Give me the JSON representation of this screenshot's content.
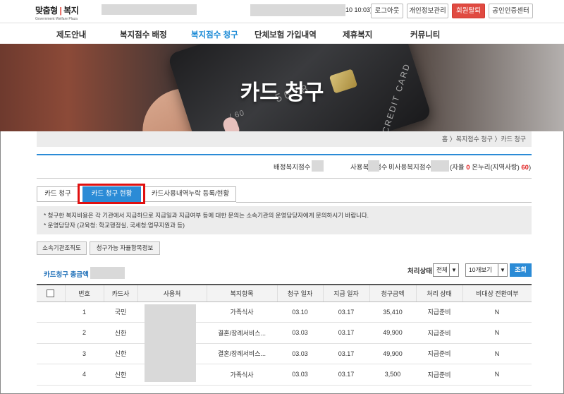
{
  "header": {
    "logo_main": "맞춤형",
    "logo_sub": "복지",
    "logo_tagline": "Government Welfare Plaza",
    "time": "10 10:03)",
    "buttons": [
      "로그아웃",
      "개인정보관리",
      "회원탈퇴",
      "공인인증센터"
    ]
  },
  "nav": [
    "제도안내",
    "복지점수 배정",
    "복지점수 청구",
    "단체보험 가입내역",
    "제휴복지",
    "커뮤니티"
  ],
  "hero": {
    "title": "카드 청구",
    "card_text": "CREDIT CARD",
    "card_number": "5678",
    "card_expiry": "/ 60"
  },
  "breadcrumb": "홈 〉복지점수 청구 〉카드 청구",
  "points": {
    "assigned_label": "배정복지점수 :",
    "used_label": "사용복지점수 :",
    "unused_label": "미사용복지점수 :",
    "detail_prefix": "(자율",
    "self_value": "0",
    "onnuri_label": "온누리(지역사랑)",
    "onnuri_value": "60",
    "detail_suffix": ")"
  },
  "tabs": [
    "카드 청구",
    "카드 청구 현황",
    "카드사용내역누락 등록/현황"
  ],
  "notice": [
    "* 청구한 복지비용은 각 기관에서 지급하므로 지급일과 지급여부 등에 대한 문의는 소속기관의 운영담당자에게 문의하시기 바랍니다.",
    "* 운영담당자 (교육청: 학교행정실, 국세청:업무지원과 등)"
  ],
  "action_buttons": [
    "소속기관조직도",
    "청구가능 자율항목정보"
  ],
  "total_label": "카드청구 총금액 :",
  "filter": {
    "status_label": "처리상태",
    "status_value": "전체",
    "page_size": "10개보기",
    "search_label": "조회"
  },
  "table": {
    "headers": [
      "",
      "번호",
      "카드사",
      "사용처",
      "복지항목",
      "청구 일자",
      "지급 일자",
      "청구금액",
      "처리 상태",
      "비대상 전환여부"
    ],
    "rows": [
      {
        "no": "1",
        "card": "국민",
        "item": "가족식사",
        "claim_date": "03.10",
        "pay_date": "03.17",
        "amount": "35,410",
        "status": "지급준비",
        "convert": "N"
      },
      {
        "no": "2",
        "card": "신한",
        "item": "결혼/장례서비스...",
        "claim_date": "03.03",
        "pay_date": "03.17",
        "amount": "49,900",
        "status": "지급준비",
        "convert": "N"
      },
      {
        "no": "3",
        "card": "신한",
        "item": "결혼/장례서비스...",
        "claim_date": "03.03",
        "pay_date": "03.17",
        "amount": "49,900",
        "status": "지급준비",
        "convert": "N"
      },
      {
        "no": "4",
        "card": "신한",
        "item": "가족식사",
        "claim_date": "03.03",
        "pay_date": "03.17",
        "amount": "3,500",
        "status": "지급준비",
        "convert": "N"
      }
    ]
  },
  "colors": {
    "accent_blue": "#2b8bd6",
    "danger_red": "#e04a41",
    "highlight_red": "#e01010"
  }
}
